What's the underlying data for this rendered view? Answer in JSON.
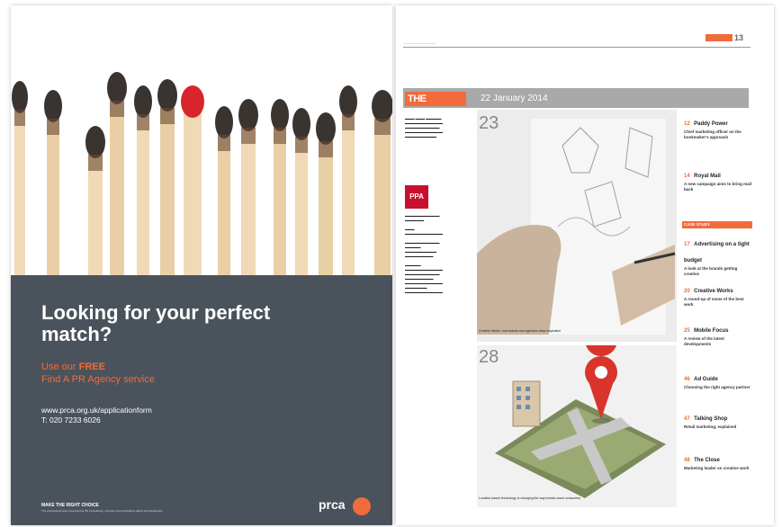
{
  "advert": {
    "headline": "Looking for your perfect match?",
    "use_our": "Use our",
    "free": "FREE",
    "find": "Find A PR Agency service",
    "url": "www.prca.org.uk/applicationform",
    "tel": "T: 020 7233 6026",
    "tagline": "MAKE THE RIGHT CHOICE",
    "fineprint": "The professional body representing PR consultancy, in-house communications teams and freelancers",
    "logo": "prca"
  },
  "magazine": {
    "page_number": "13",
    "masthead": "THE",
    "date": "22 January 2014",
    "ppa_badge": "PPA",
    "features": [
      {
        "number": "23",
        "caption": "Creative Works: how brands and agencies draw inspiration"
      },
      {
        "number": "28",
        "caption": "Location-based technology is changing the way brands reach consumers"
      }
    ],
    "sidebar_items": [
      {
        "number": "12",
        "title": "Paddy Power",
        "body": "Chief marketing officer on the bookmaker's approach"
      },
      {
        "number": "14",
        "title": "Royal Mail",
        "body": "A new campaign aims to bring mail back"
      },
      {
        "number": "17",
        "title": "Advertising on a tight budget",
        "body": "A look at the brands getting creative"
      },
      {
        "number": "20",
        "title": "Creative Works",
        "body": "A round-up of some of the best work"
      },
      {
        "number": "25",
        "title": "Mobile Focus",
        "body": "A review of the latest developments"
      },
      {
        "number": "46",
        "title": "Ad Guide",
        "body": "Choosing the right agency partner"
      },
      {
        "number": "47",
        "title": "Talking Shop",
        "body": "Retail marketing, explained"
      },
      {
        "number": "48",
        "title": "The Close",
        "body": "Marketing leader on creative work"
      }
    ],
    "section_label": "CASE STUDY"
  },
  "colors": {
    "accent": "#f26b3a",
    "panel": "#4a535c",
    "mast_bar": "#a7a9ab",
    "ppa_red": "#c8102e"
  }
}
